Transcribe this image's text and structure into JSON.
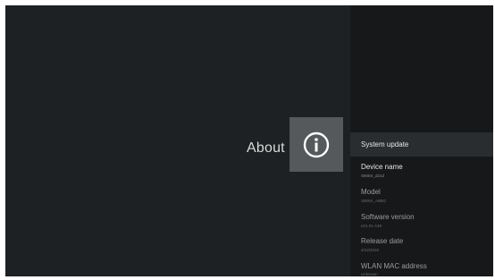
{
  "page": {
    "title": "About",
    "icon": "info-icon"
  },
  "menu": {
    "items": [
      {
        "title": "System update",
        "subtitle": "",
        "state": "selected"
      },
      {
        "title": "Device name",
        "subtitle": "S905X_d21d",
        "state": "bright"
      },
      {
        "title": "Model",
        "subtitle": "S905X_A9BG",
        "state": "dim"
      },
      {
        "title": "Software version",
        "subtitle": "e21.01.A49",
        "state": "dim"
      },
      {
        "title": "Release date",
        "subtitle": "4/12/2016",
        "state": "dim"
      },
      {
        "title": "WLAN MAC address",
        "subtitle": "Unknown",
        "state": "dim"
      }
    ]
  },
  "colors": {
    "background": "#1e2123",
    "panel": "#161819",
    "icon_tile": "#55595c",
    "selected_row": "#2a2d2f"
  }
}
